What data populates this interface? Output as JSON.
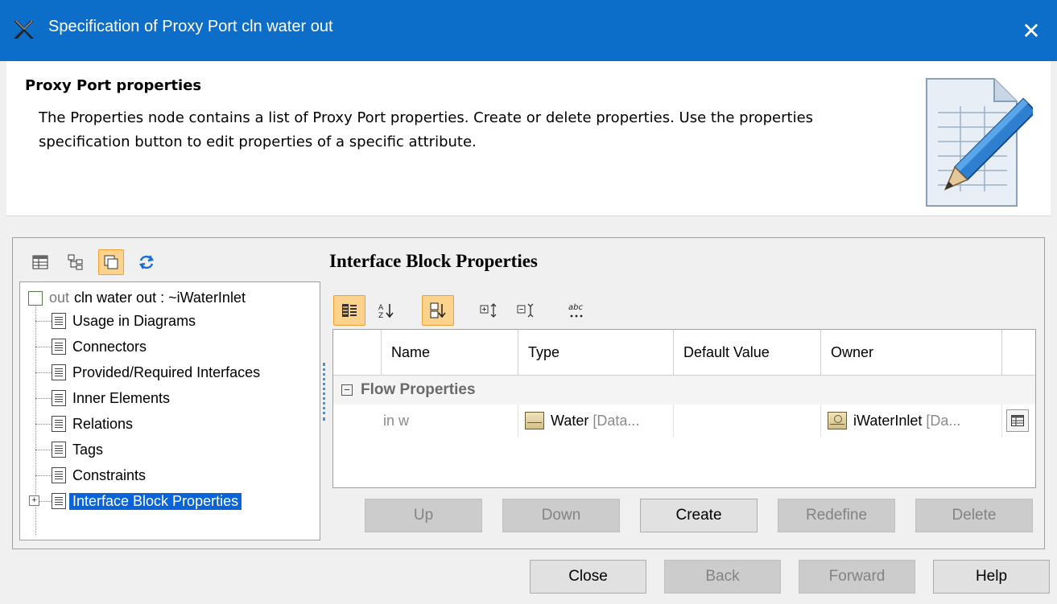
{
  "window": {
    "title": "Specification of Proxy Port cln water out",
    "close_glyph": "✕"
  },
  "info": {
    "heading": "Proxy Port properties",
    "description": "The Properties node contains a list of Proxy Port properties. Create or delete properties. Use the properties specification button to edit properties of a specific attribute."
  },
  "tree": {
    "root_keyword": "out",
    "root_label": "cln water out : ~iWaterInlet",
    "items": [
      {
        "label": "Usage in Diagrams"
      },
      {
        "label": "Connectors"
      },
      {
        "label": "Provided/Required Interfaces"
      },
      {
        "label": "Inner Elements"
      },
      {
        "label": "Relations"
      },
      {
        "label": "Tags"
      },
      {
        "label": "Constraints"
      },
      {
        "label": "Interface Block Properties",
        "selected": true,
        "expander": "+"
      }
    ]
  },
  "panel": {
    "title": "Interface Block Properties"
  },
  "toolbar": {
    "sort_label": "abc"
  },
  "grid": {
    "columns": [
      "Name",
      "Type",
      "Default Value",
      "Owner"
    ],
    "group": {
      "collapse_glyph": "−",
      "label": "Flow Properties"
    },
    "rows": [
      {
        "name": "in w",
        "type_name": "Water",
        "type_suffix": "[Data...",
        "default": "",
        "owner_name": "iWaterInlet",
        "owner_suffix": "[Da..."
      }
    ]
  },
  "row_buttons": {
    "up": "Up",
    "down": "Down",
    "create": "Create",
    "redefine": "Redefine",
    "delete": "Delete"
  },
  "dialog_buttons": {
    "close": "Close",
    "back": "Back",
    "forward": "Forward",
    "help": "Help"
  }
}
